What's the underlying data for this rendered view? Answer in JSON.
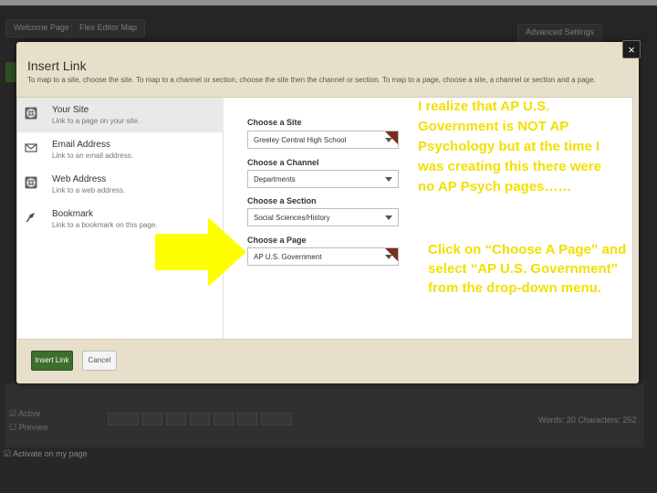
{
  "background": {
    "tabs": [
      "Welcome Page",
      "Flex Editor Map"
    ],
    "advanced_settings": "Advanced Settings",
    "status": "Words: 20 Characters: 252",
    "checkboxes": [
      "Active",
      "Preview"
    ],
    "activate_label": "Activate on my page"
  },
  "dialog": {
    "title": "Insert Link",
    "instructions": "To map to a site, choose the site. To map to a channel or section, choose the site then the channel or section. To map to a page, choose a site, a channel or section and a page.",
    "close_label": "×",
    "link_types": [
      {
        "label": "Your Site",
        "desc": "Link to a page on your site.",
        "icon": "globe-icon"
      },
      {
        "label": "Email Address",
        "desc": "Link to an email address.",
        "icon": "envelope-icon"
      },
      {
        "label": "Web Address",
        "desc": "Link to a web address.",
        "icon": "globe-icon"
      },
      {
        "label": "Bookmark",
        "desc": "Link to a bookmark on this page.",
        "icon": "bookmark-icon"
      }
    ],
    "choose_site_label": "Choose a Site",
    "choose_site_value": "Greeley Central High School",
    "choose_channel_label": "Choose a Channel",
    "choose_channel_value": "Departments",
    "choose_section_label": "Choose a Section",
    "choose_section_value": "Social Sciences/History",
    "choose_page_label": "Choose a Page",
    "choose_page_value": "AP U.S. Government",
    "insert_label": "Insert Link",
    "cancel_label": "Cancel"
  },
  "annotations": {
    "note": "I realize that AP U.S. Government is NOT AP Psychology but at the time I was creating this there were no AP Psych pages……",
    "instruction": "Click on “Choose A Page” and select “AP U.S. Government” from the drop-down menu."
  },
  "colors": {
    "annotation": "#f2e000",
    "arrow": "#ffff00",
    "insert_button": "#3f6d2a"
  }
}
